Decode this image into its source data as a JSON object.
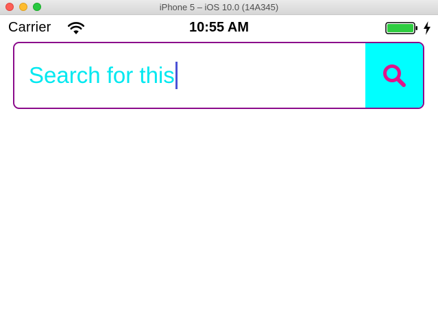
{
  "window": {
    "title": "iPhone 5 – iOS 10.0 (14A345)"
  },
  "status_bar": {
    "carrier": "Carrier",
    "time": "10:55 AM",
    "icons": [
      "wifi-icon",
      "battery-icon",
      "charging-icon"
    ],
    "battery_level": 1.0
  },
  "search": {
    "value": "Search for this",
    "button_icon": "search-icon"
  },
  "colors": {
    "border": "#8b0a8b",
    "text": "#00e8f0",
    "button_background": "#00ffff",
    "icon": "#e0148a",
    "caret": "#4b52d6",
    "battery_fill": "#2ecc40"
  }
}
